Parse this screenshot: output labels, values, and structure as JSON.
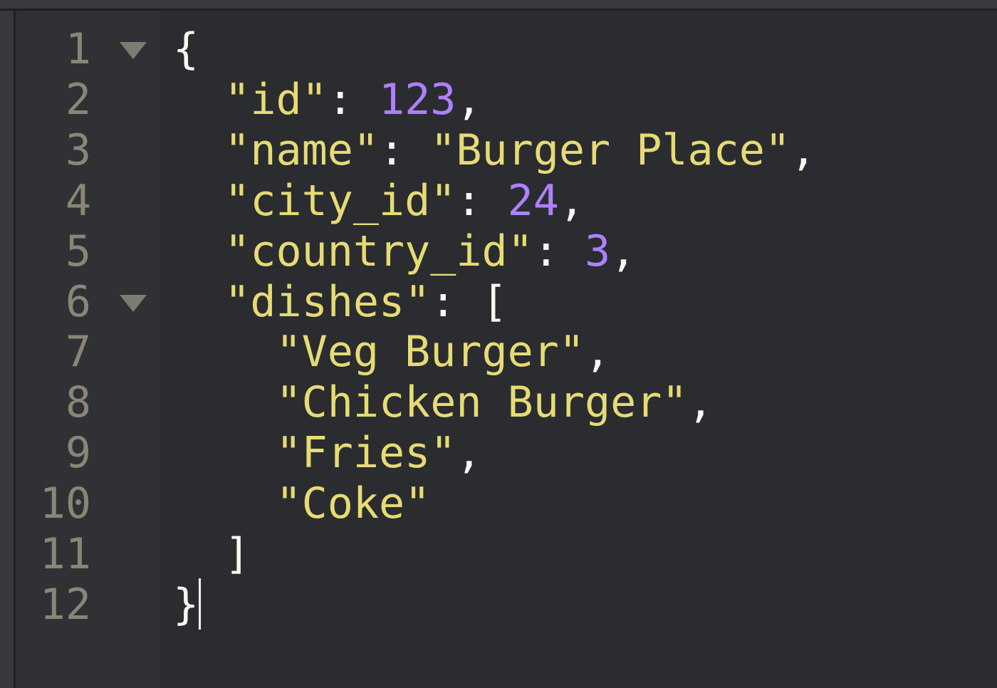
{
  "editor": {
    "line_numbers": [
      "1",
      "2",
      "3",
      "4",
      "5",
      "6",
      "7",
      "8",
      "9",
      "10",
      "11",
      "12"
    ],
    "folded_lines": [
      "1",
      "6"
    ],
    "lines": [
      {
        "indent": "",
        "parts": [
          {
            "t": "{",
            "c": "p"
          }
        ]
      },
      {
        "indent": "  ",
        "parts": [
          {
            "t": "\"id\"",
            "c": "s"
          },
          {
            "t": ": ",
            "c": "p"
          },
          {
            "t": "123",
            "c": "n"
          },
          {
            "t": ",",
            "c": "p"
          }
        ]
      },
      {
        "indent": "  ",
        "parts": [
          {
            "t": "\"name\"",
            "c": "s"
          },
          {
            "t": ": ",
            "c": "p"
          },
          {
            "t": "\"Burger Place\"",
            "c": "s"
          },
          {
            "t": ",",
            "c": "p"
          }
        ]
      },
      {
        "indent": "  ",
        "parts": [
          {
            "t": "\"city_id\"",
            "c": "s"
          },
          {
            "t": ": ",
            "c": "p"
          },
          {
            "t": "24",
            "c": "n"
          },
          {
            "t": ",",
            "c": "p"
          }
        ]
      },
      {
        "indent": "  ",
        "parts": [
          {
            "t": "\"country_id\"",
            "c": "s"
          },
          {
            "t": ": ",
            "c": "p"
          },
          {
            "t": "3",
            "c": "n"
          },
          {
            "t": ",",
            "c": "p"
          }
        ]
      },
      {
        "indent": "  ",
        "parts": [
          {
            "t": "\"dishes\"",
            "c": "s"
          },
          {
            "t": ": [",
            "c": "p"
          }
        ]
      },
      {
        "indent": "    ",
        "parts": [
          {
            "t": "\"Veg Burger\"",
            "c": "s"
          },
          {
            "t": ",",
            "c": "p"
          }
        ]
      },
      {
        "indent": "    ",
        "parts": [
          {
            "t": "\"Chicken Burger\"",
            "c": "s"
          },
          {
            "t": ",",
            "c": "p"
          }
        ]
      },
      {
        "indent": "    ",
        "parts": [
          {
            "t": "\"Fries\"",
            "c": "s"
          },
          {
            "t": ",",
            "c": "p"
          }
        ]
      },
      {
        "indent": "    ",
        "parts": [
          {
            "t": "\"Coke\"",
            "c": "s"
          }
        ]
      },
      {
        "indent": "  ",
        "parts": [
          {
            "t": "]",
            "c": "p"
          }
        ]
      },
      {
        "indent": "",
        "parts": [
          {
            "t": "}",
            "c": "p"
          }
        ]
      }
    ],
    "colors": {
      "string": "#e6db74",
      "number": "#ae81ff",
      "punctuation": "#f8f8f2",
      "line_number": "#8a8677"
    }
  }
}
